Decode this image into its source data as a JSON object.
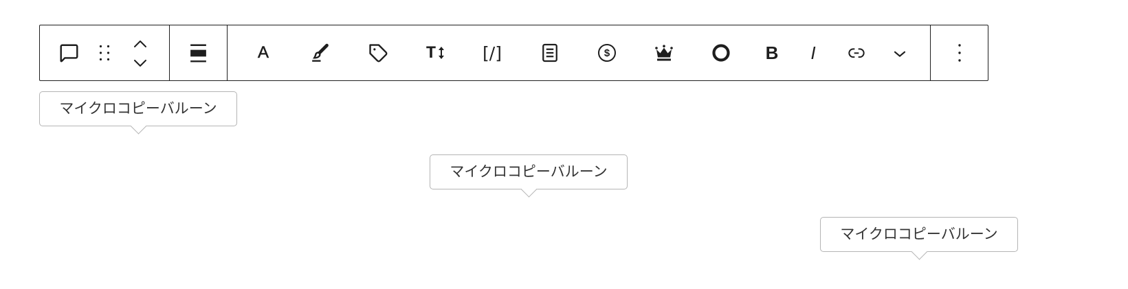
{
  "colors": {
    "background": "#ffffff",
    "ink": "#1e1e1e",
    "balloon_border": "#b4b4b4",
    "balloon_text": "#333333"
  },
  "toolbar": {
    "block": {
      "comment_icon": "comment-icon",
      "drag_icon": "drag-handle-icon",
      "move_up_icon": "chevron-up-icon",
      "move_down_icon": "chevron-down-icon"
    },
    "align": {
      "icon": "align-none-icon"
    },
    "format": {
      "text_color": {
        "icon": "text-color-icon",
        "glyph": "A"
      },
      "highlight": {
        "icon": "brush-icon"
      },
      "tag": {
        "icon": "tag-icon"
      },
      "font_size": {
        "icon": "font-size-icon",
        "glyph": "T"
      },
      "shortcode": {
        "icon": "shortcode-icon",
        "glyph": "[/]"
      },
      "list": {
        "icon": "document-list-icon"
      },
      "price": {
        "icon": "dollar-circle-icon",
        "glyph": "$"
      },
      "crown": {
        "icon": "crown-icon"
      },
      "circle": {
        "icon": "circle-icon"
      },
      "bold": {
        "icon": "bold-icon",
        "glyph": "B"
      },
      "italic": {
        "icon": "italic-icon",
        "glyph": "I"
      },
      "link": {
        "icon": "link-icon"
      },
      "more_formats": {
        "icon": "chevron-down-icon"
      }
    },
    "options": {
      "icon": "more-vertical-icon"
    }
  },
  "balloons": [
    {
      "text": "マイクロコピーバルーン"
    },
    {
      "text": "マイクロコピーバルーン"
    },
    {
      "text": "マイクロコピーバルーン"
    }
  ]
}
